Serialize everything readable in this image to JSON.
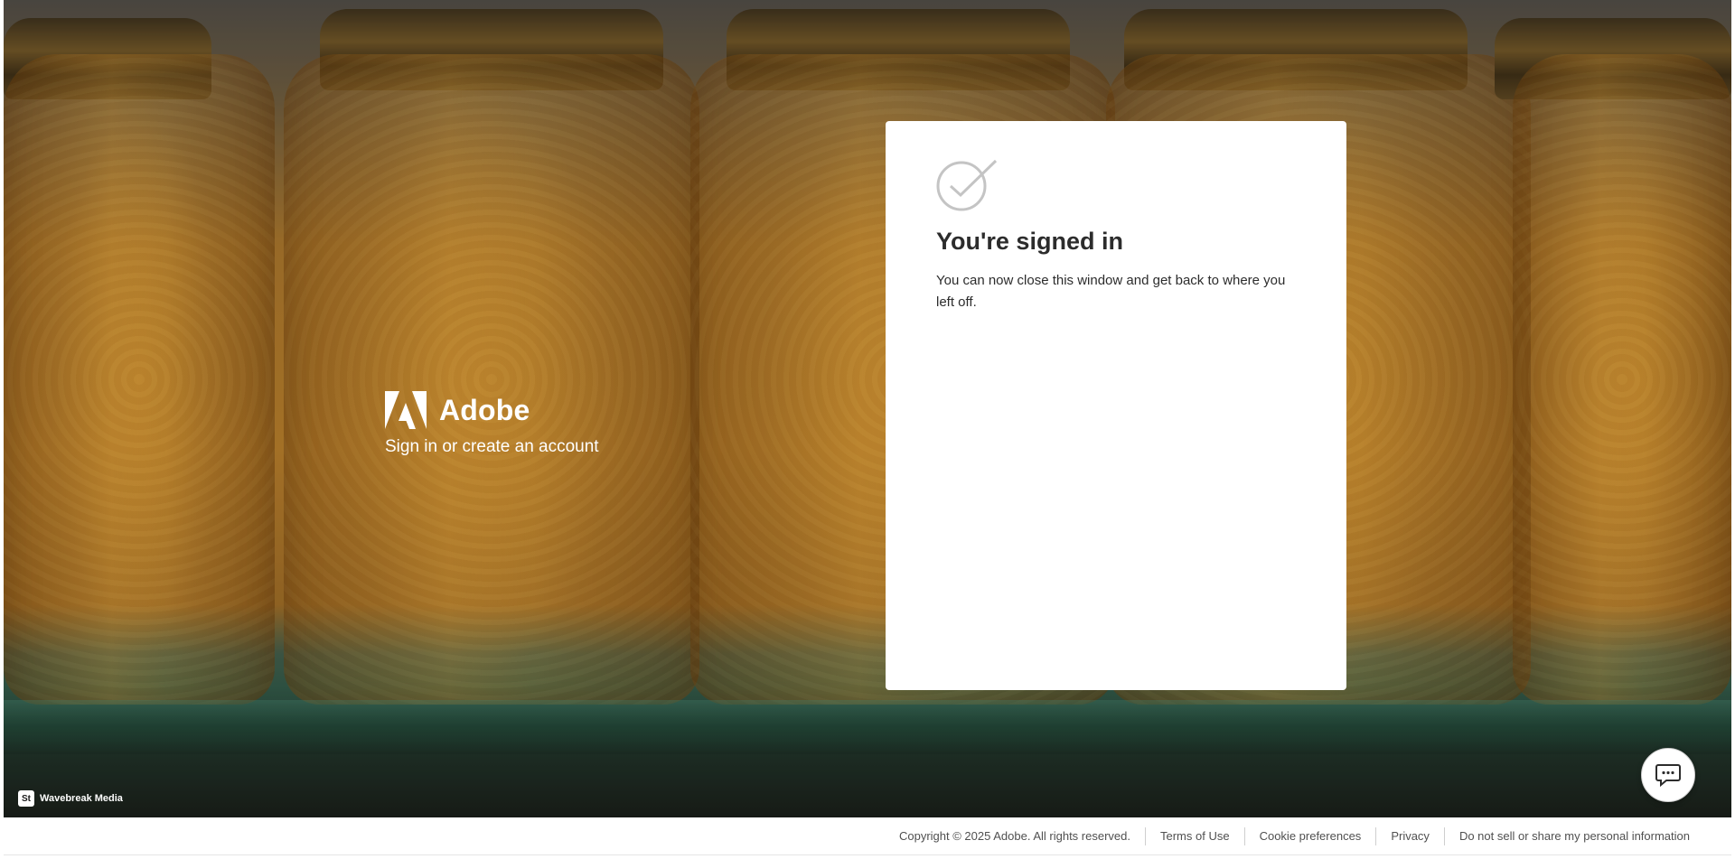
{
  "brand": {
    "name": "Adobe",
    "tagline": "Sign in or create an account",
    "logo_icon": "adobe-logo-icon"
  },
  "card": {
    "icon": "checkmark-circle-icon",
    "title": "You're signed in",
    "message": "You can now close this window and get back to where you left off."
  },
  "background_credit": {
    "icon_text": "St",
    "label": "Wavebreak Media"
  },
  "chat": {
    "icon": "chat-bubble-icon"
  },
  "footer": {
    "copyright": "Copyright © 2025 Adobe. All rights reserved.",
    "links": [
      "Terms of Use",
      "Cookie preferences",
      "Privacy",
      "Do not sell or share my personal information"
    ]
  },
  "colors": {
    "card_bg": "#ffffff",
    "text_dark": "#2c2c2c",
    "footer_text": "#505050",
    "check_stroke": "#c4c4c4"
  }
}
